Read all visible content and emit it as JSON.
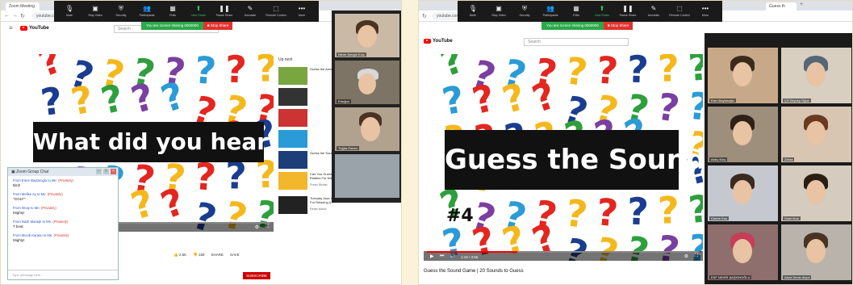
{
  "zoom_toolbar": {
    "buttons": [
      {
        "icon": "microphone-icon",
        "label": "Mute"
      },
      {
        "icon": "camera-icon",
        "label": "Stop Video"
      },
      {
        "icon": "shield-icon",
        "label": "Security"
      },
      {
        "icon": "people-icon",
        "label": "Participants"
      },
      {
        "icon": "bar-chart-icon",
        "label": "Polls"
      },
      {
        "icon": "share-icon",
        "label": "New Share"
      },
      {
        "icon": "pause-icon",
        "label": "Pause Share"
      },
      {
        "icon": "pen-icon",
        "label": "Annotate"
      },
      {
        "icon": "mouse-icon",
        "label": "Remote Control"
      },
      {
        "icon": "more-icon",
        "label": "More"
      }
    ],
    "sharing_message": "You are screen sharing",
    "meeting_id": "0000000",
    "stop_share": "Stop Share"
  },
  "left": {
    "tab_title": "Zoom Meeting",
    "url": "youtube.com/watch",
    "search_placeholder": "Search",
    "youtube_logo": "YouTube",
    "banner": "What did you hear?",
    "up_next": "Up next",
    "suggestions": [
      {
        "title": "Guess the Animal Sound"
      },
      {
        "title": ""
      },
      {
        "title": ""
      },
      {
        "title": ""
      },
      {
        "title": "Guess the Sound"
      },
      {
        "title": "Can You Guess The Food By Emoji? | Riddles For Kids!"
      },
      {
        "title": "Tuesday Jazz In Piano – Piano JAZZ Music For Relaxing &..."
      }
    ],
    "suggestion_meta": [
      "Fresh Studio",
      "Relax Music"
    ],
    "chat": {
      "title": "Zoom Group Chat",
      "messages": [
        {
          "from": "From Emre Baytaroglu to Me:",
          "privacy": "(Privately)",
          "text": "Bird!"
        },
        {
          "from": "From Melike Ay to Me:",
          "privacy": "(Privately)",
          "text": "\"GOLF\""
        },
        {
          "from": "From Ilmay to Me:",
          "privacy": "(Privately)",
          "text": "Mighty!"
        },
        {
          "from": "From Nazlı Maraşlı to Me:",
          "privacy": "(Privately)",
          "text": "T beat"
        },
        {
          "from": "From Mecdi Karasu to Me:",
          "privacy": "(Privately)",
          "text": "Mighty!"
        }
      ],
      "input_placeholder": "Type message here..."
    },
    "actions": [
      "2.5K",
      "158",
      "SHARE",
      "SAVE"
    ],
    "subscribe": "SUBSCRIBE",
    "participants": [
      "Nevin Şengül Kılıç",
      "Ertuğrul",
      "Tuğba Özkan",
      ""
    ]
  },
  "right": {
    "tab_title": "Guess th",
    "url": "youtube.com/watch",
    "search_placeholder": "Search",
    "youtube_logo": "YouTube",
    "banner": "Guess the Sound",
    "episode": "#4",
    "timecode": "1:18 / 3:56",
    "video_title": "Guess the Sound Game | 20 Sounds to Guess",
    "participants": [
      "Eren Baytaroğlu",
      "ÇS Zeynep Oğuz",
      "Ardıç Kılıç",
      "Zehra",
      "Cemre Koç",
      "Ozan Koç",
      "ESF NEHİR ŞAŞKINOĞLU",
      "Alara Deniz Akyol"
    ]
  },
  "colors": {
    "toolbar_bg": "#1a1a1a",
    "share_green": "#2da84a",
    "stop_red": "#e0332d",
    "youtube_red": "#ff0000",
    "frame_bg": "#fbf3d9"
  }
}
